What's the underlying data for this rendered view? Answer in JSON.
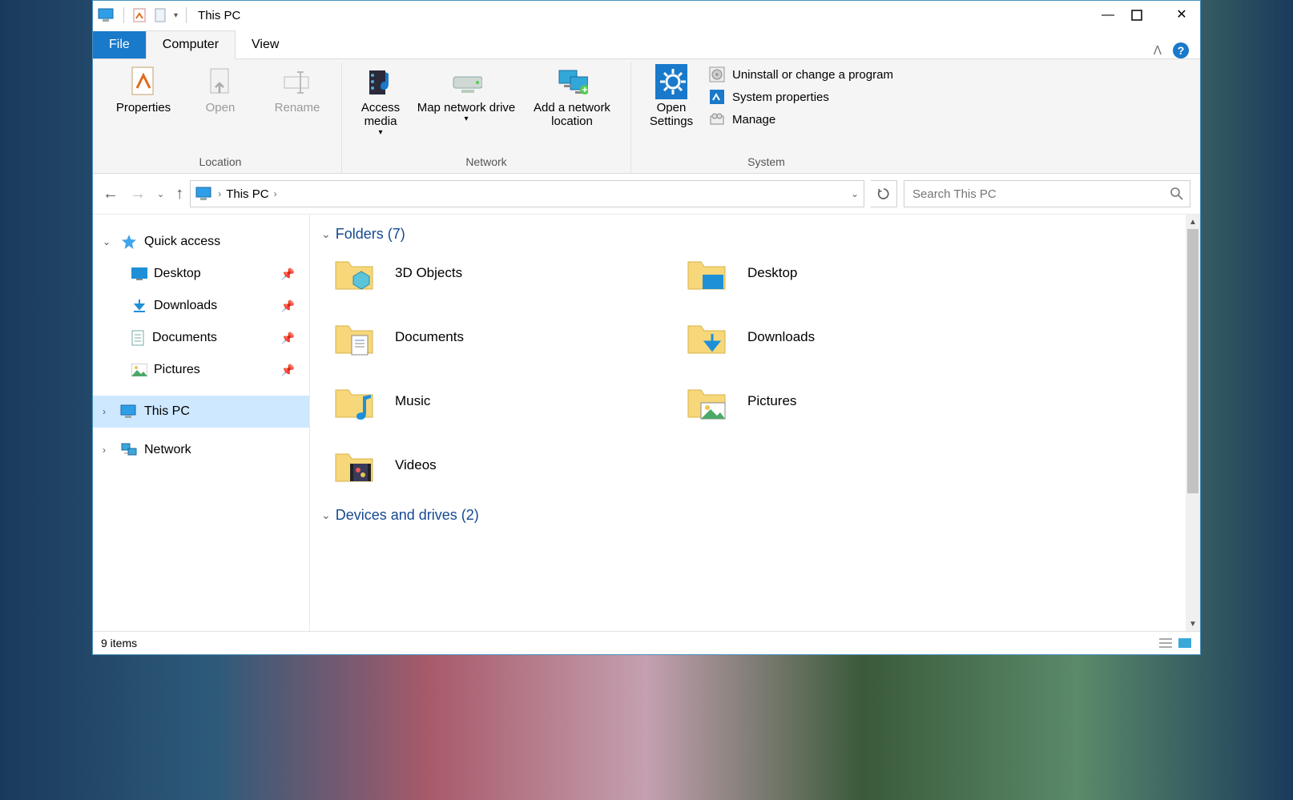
{
  "title": "This PC",
  "tabs": {
    "file": "File",
    "computer": "Computer",
    "view": "View"
  },
  "ribbon": {
    "location": {
      "properties": "Properties",
      "open": "Open",
      "rename": "Rename",
      "group": "Location"
    },
    "network": {
      "access": "Access media",
      "map": "Map network drive",
      "add": "Add a network location",
      "group": "Network"
    },
    "system": {
      "open_settings": "Open Settings",
      "uninstall": "Uninstall or change a program",
      "sysprops": "System properties",
      "manage": "Manage",
      "group": "System"
    }
  },
  "address": {
    "location": "This PC"
  },
  "search": {
    "placeholder": "Search This PC"
  },
  "sidebar": {
    "quick": "Quick access",
    "items": [
      "Desktop",
      "Downloads",
      "Documents",
      "Pictures"
    ],
    "thispc": "This PC",
    "network": "Network"
  },
  "sections": {
    "folders": "Folders (7)",
    "drives": "Devices and drives (2)"
  },
  "folders": [
    "3D Objects",
    "Desktop",
    "Documents",
    "Downloads",
    "Music",
    "Pictures",
    "Videos"
  ],
  "status": {
    "items": "9 items"
  }
}
